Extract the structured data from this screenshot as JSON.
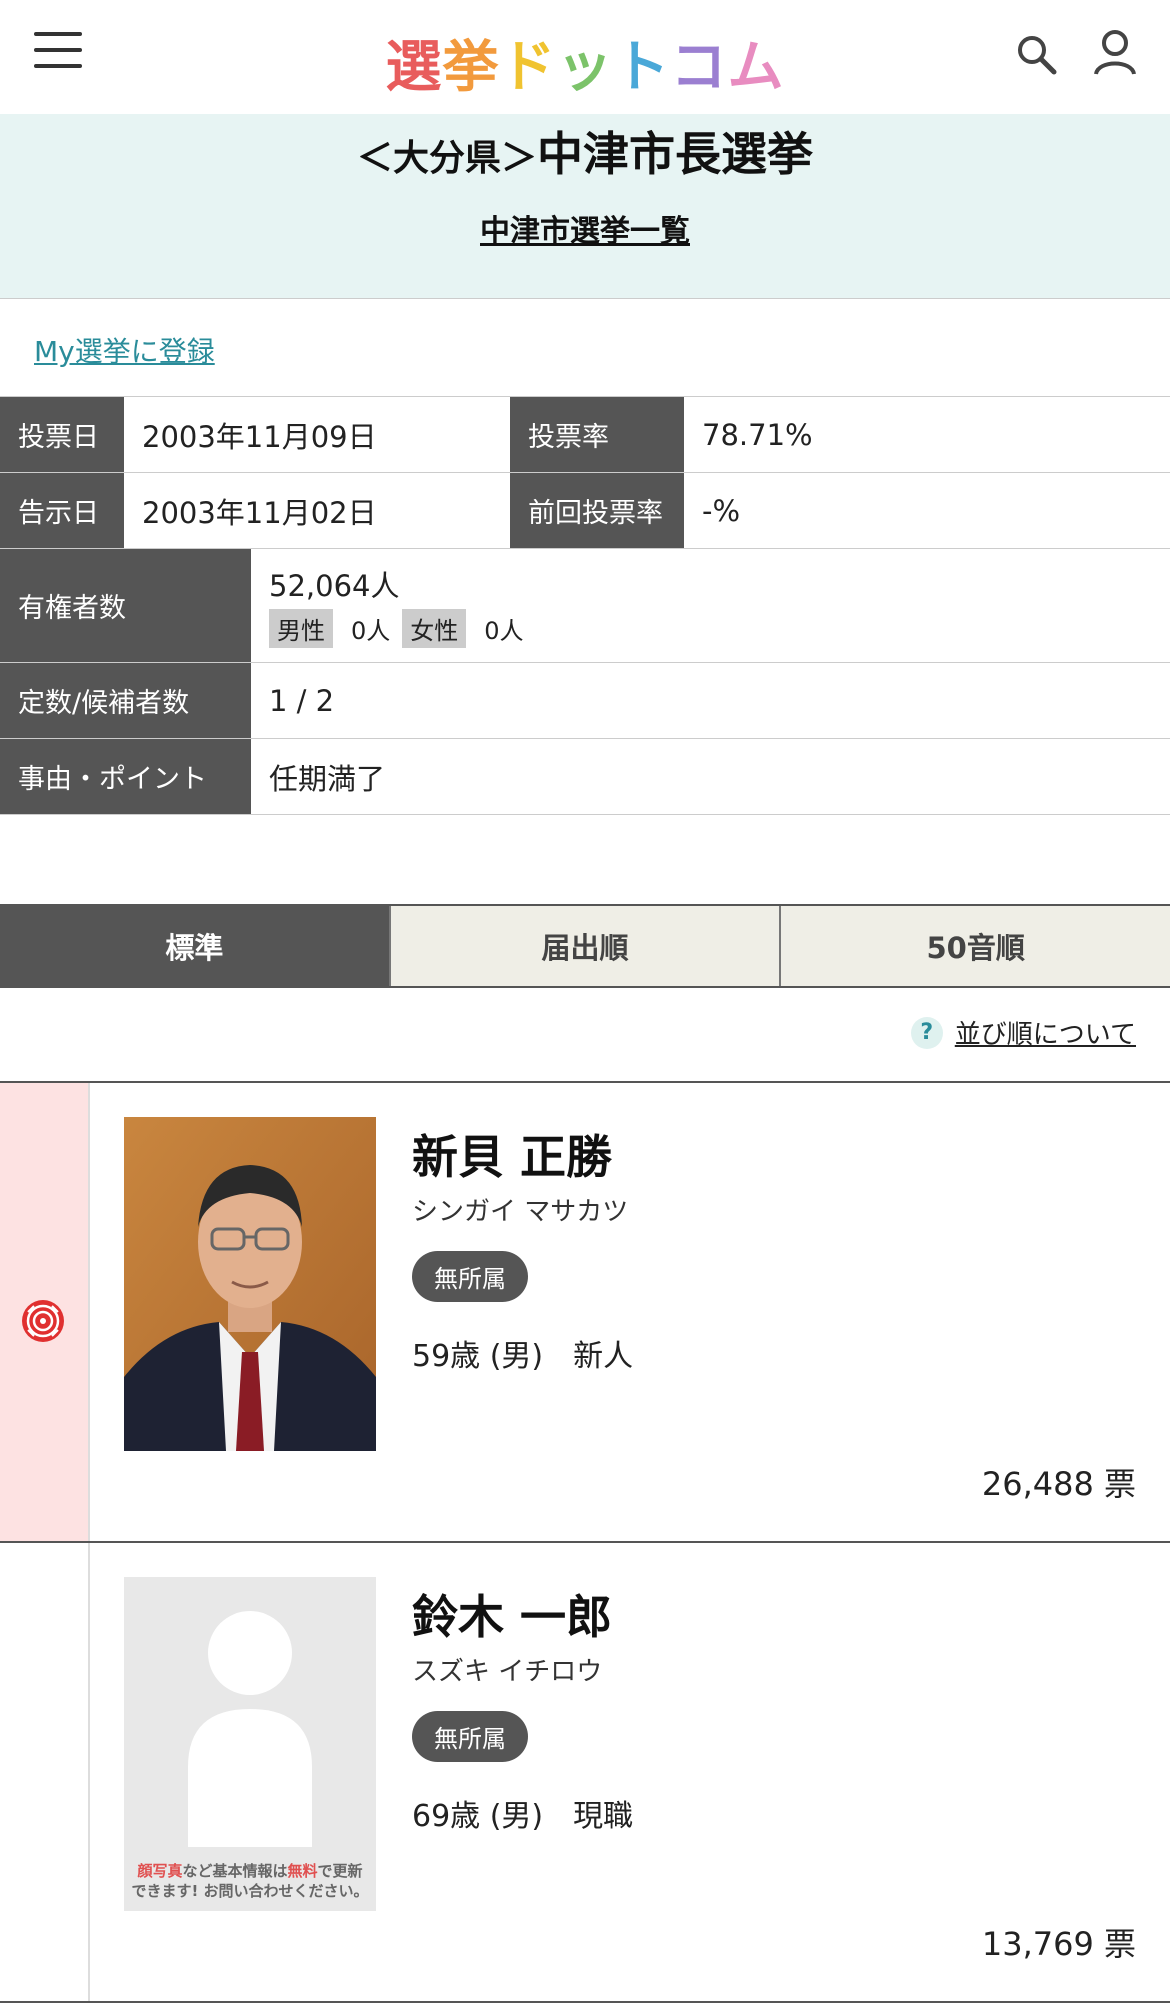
{
  "header": {
    "logo_chars": [
      {
        "t": "選",
        "color": "#e85c5c"
      },
      {
        "t": "挙",
        "color": "#f29a3d"
      },
      {
        "t": "ド",
        "color": "#f0c330"
      },
      {
        "t": "ッ",
        "color": "#7cc36a"
      },
      {
        "t": "ト",
        "color": "#4aa8d8"
      },
      {
        "t": "コ",
        "color": "#9b7fd1"
      },
      {
        "t": "ム",
        "color": "#e88cc0"
      }
    ]
  },
  "title": {
    "pref": "＜大分県＞",
    "election": "中津市長選挙",
    "city_list_link": "中津市選挙一覧"
  },
  "my_election_link": "My選挙に登録",
  "info": {
    "vote_date_label": "投票日",
    "vote_date": "2003年11月09日",
    "turnout_label": "投票率",
    "turnout": "78.71%",
    "notice_date_label": "告示日",
    "notice_date": "2003年11月02日",
    "prev_turnout_label": "前回投票率",
    "prev_turnout": "-%",
    "voters_label": "有権者数",
    "voters": "52,064人",
    "male_label": "男性",
    "male": "0人",
    "female_label": "女性",
    "female": "0人",
    "seats_label": "定数/候補者数",
    "seats": "1 / 2",
    "reason_label": "事由・ポイント",
    "reason": "任期満了"
  },
  "tabs": [
    "標準",
    "届出順",
    "50音順"
  ],
  "sort_help": "並び順について",
  "candidates": [
    {
      "name": "新貝 正勝",
      "kana": "シンガイ マサカツ",
      "party": "無所属",
      "meta": "59歳 (男)　新人",
      "votes": "26,488 票",
      "elected": true
    },
    {
      "name": "鈴木 一郎",
      "kana": "スズキ イチロウ",
      "party": "無所属",
      "meta": "69歳 (男)　現職",
      "votes": "13,769 票",
      "elected": false,
      "photo_note_1a": "顔写真",
      "photo_note_1b": "など基本情報は",
      "photo_note_1c": "無料",
      "photo_note_1d": "で更新",
      "photo_note_2": "できます! お問い合わせください。"
    }
  ]
}
